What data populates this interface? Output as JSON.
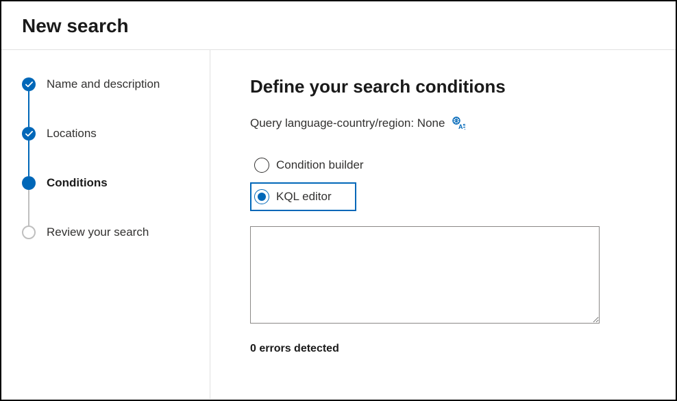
{
  "header": {
    "title": "New search"
  },
  "sidebar": {
    "steps": [
      {
        "label": "Name and description",
        "state": "completed"
      },
      {
        "label": "Locations",
        "state": "completed"
      },
      {
        "label": "Conditions",
        "state": "current"
      },
      {
        "label": "Review your search",
        "state": "upcoming"
      }
    ]
  },
  "main": {
    "heading": "Define your search conditions",
    "query_language_label": "Query language-country/region: None",
    "radio": {
      "condition_builder": "Condition builder",
      "kql_editor": "KQL editor",
      "selected": "kql_editor"
    },
    "kql_value": "",
    "errors_text": "0 errors detected"
  },
  "colors": {
    "primary": "#0067b8",
    "border_gray": "#bfbfbf"
  }
}
